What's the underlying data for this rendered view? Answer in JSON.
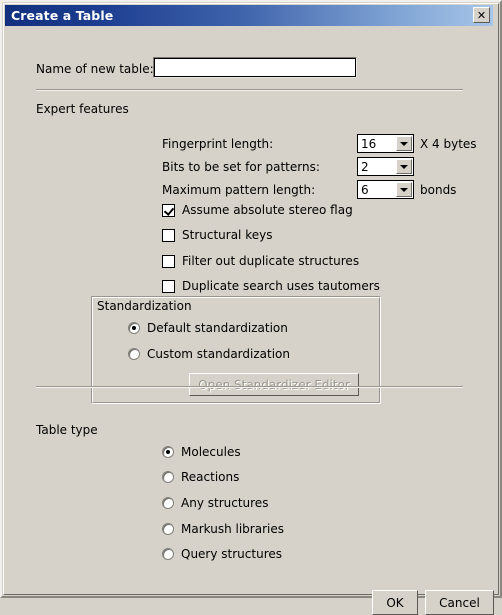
{
  "window": {
    "title": "Create a Table",
    "close_icon": "close-icon",
    "close_label": "✕"
  },
  "form": {
    "name_label": "Name of new table:",
    "name_value": "",
    "name_placeholder": ""
  },
  "expert": {
    "section_label": "Expert features",
    "fields": [
      {
        "label": "Fingerprint length:",
        "value": "16",
        "suffix": "X 4 bytes"
      },
      {
        "label": "Bits to be set for patterns:",
        "value": "2",
        "suffix": ""
      },
      {
        "label": "Maximum pattern length:",
        "value": "6",
        "suffix": "bonds"
      }
    ],
    "checkboxes": [
      {
        "label": "Assume absolute stereo flag",
        "checked": true
      },
      {
        "label": "Structural keys",
        "checked": false
      },
      {
        "label": "Filter out duplicate structures",
        "checked": false
      },
      {
        "label": "Duplicate search uses tautomers",
        "checked": false
      }
    ]
  },
  "standardization": {
    "group_title": "Standardization",
    "options": [
      {
        "label": "Default standardization",
        "selected": true
      },
      {
        "label": "Custom standardization",
        "selected": false
      }
    ],
    "editor_button": "Open Standardizer Editor",
    "editor_button_enabled": false
  },
  "table_type": {
    "section_label": "Table type",
    "options": [
      {
        "label": "Molecules",
        "selected": true
      },
      {
        "label": "Reactions",
        "selected": false
      },
      {
        "label": "Any structures",
        "selected": false
      },
      {
        "label": "Markush libraries",
        "selected": false
      },
      {
        "label": "Query structures",
        "selected": false
      }
    ]
  },
  "buttons": {
    "ok": "OK",
    "cancel": "Cancel"
  },
  "colors": {
    "dialog_background": "#d6d2ca",
    "titlebar_start": "#12307e",
    "titlebar_end": "#a7c5e8",
    "field_background": "#ffffff",
    "disabled_text": "#9c9990"
  }
}
